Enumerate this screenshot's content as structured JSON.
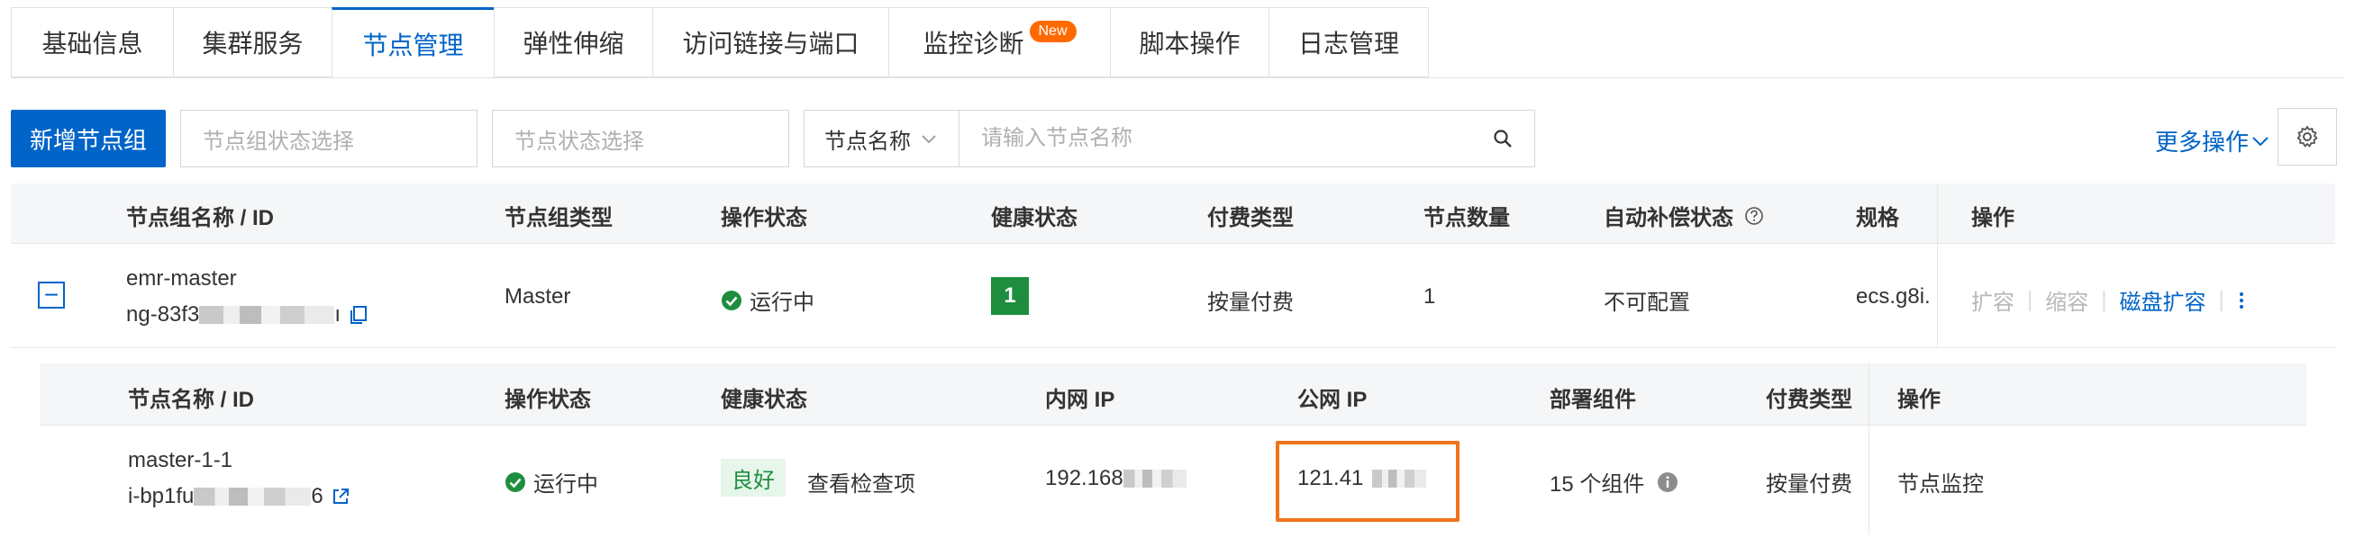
{
  "tabs": [
    {
      "label": "基础信息"
    },
    {
      "label": "集群服务"
    },
    {
      "label": "节点管理",
      "active": true
    },
    {
      "label": "弹性伸缩"
    },
    {
      "label": "访问链接与端口"
    },
    {
      "label": "监控诊断",
      "badge": "New"
    },
    {
      "label": "脚本操作"
    },
    {
      "label": "日志管理"
    }
  ],
  "toolbar": {
    "add_group_label": "新增节点组",
    "group_status_placeholder": "节点组状态选择",
    "node_status_placeholder": "节点状态选择",
    "search_type": "节点名称",
    "search_placeholder": "请输入节点名称",
    "more_actions": "更多操作"
  },
  "group_table": {
    "headers": {
      "name": "节点组名称 / ID",
      "type": "节点组类型",
      "op_status": "操作状态",
      "health": "健康状态",
      "pay": "付费类型",
      "count": "节点数量",
      "auto": "自动补偿状态",
      "spec": "规格",
      "ops": "操作"
    },
    "row": {
      "expand_symbol": "−",
      "name": "emr-master",
      "id_prefix": "ng-83f3",
      "id_suffix": "ı",
      "type": "Master",
      "op_status": "运行中",
      "health_count": "1",
      "pay": "按量付费",
      "count": "1",
      "auto": "不可配置",
      "spec": "ecs.g8i.",
      "action_scale_out": "扩容",
      "action_scale_in": "缩容",
      "action_disk": "磁盘扩容"
    }
  },
  "node_table": {
    "headers": {
      "name": "节点名称 / ID",
      "op_status": "操作状态",
      "health": "健康状态",
      "private_ip": "内网 IP",
      "public_ip": "公网 IP",
      "components": "部署组件",
      "pay": "付费类型",
      "ops": "操作"
    },
    "row": {
      "name": "master-1-1",
      "id_prefix": "i-bp1fu",
      "id_suffix": "6",
      "op_status": "运行中",
      "health_tag": "良好",
      "view_checks": "查看检查项",
      "private_ip_prefix": "192.168",
      "public_ip_prefix": "121.41",
      "components": "15 个组件",
      "pay": "按量付费",
      "monitor": "节点监控"
    }
  },
  "colors": {
    "primary": "#0064c8",
    "success": "#1e8e3e",
    "highlight": "#f07318",
    "badge": "#ff6a00"
  }
}
